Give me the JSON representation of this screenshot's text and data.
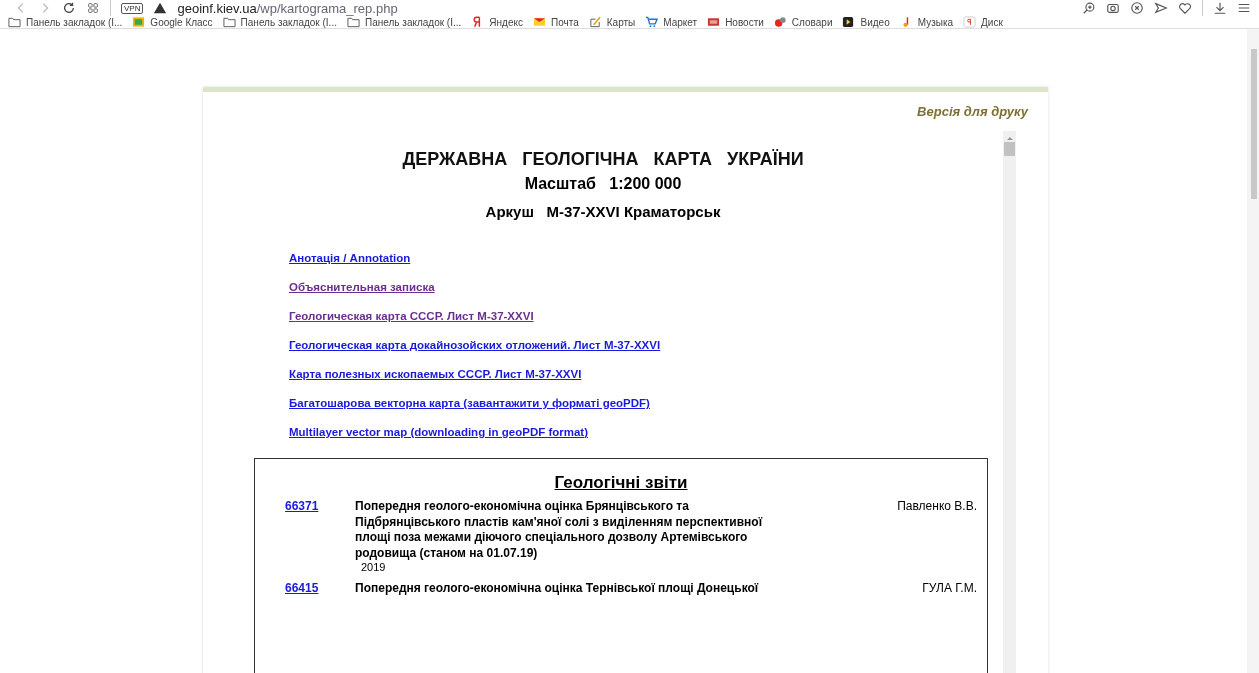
{
  "browser": {
    "url_host": "geoinf.kiev.ua",
    "url_path": "/wp/kartograma_rep.php",
    "vpn_label": "VPN"
  },
  "bookmarks": [
    {
      "label": "Панель закладок (I...",
      "kind": "folder"
    },
    {
      "label": "Google Класс",
      "kind": "classroom"
    },
    {
      "label": "Панель закладок (I...",
      "kind": "folder"
    },
    {
      "label": "Панель закладок (I...",
      "kind": "folder"
    },
    {
      "label": "Яндекс",
      "kind": "ya"
    },
    {
      "label": "Почта",
      "kind": "mail"
    },
    {
      "label": "Карты",
      "kind": "maps"
    },
    {
      "label": "Маркет",
      "kind": "cart"
    },
    {
      "label": "Новости",
      "kind": "news"
    },
    {
      "label": "Словари",
      "kind": "dict"
    },
    {
      "label": "Видео",
      "kind": "video"
    },
    {
      "label": "Музыка",
      "kind": "music"
    },
    {
      "label": "Диск",
      "kind": "disk"
    }
  ],
  "print_link": "Версія для друку",
  "heading": {
    "title": "ДЕРЖАВНА   ГЕОЛОГІЧНА   КАРТА   УКРАЇНИ",
    "scale": "Масштаб   1:200 000",
    "sheet": "Аркуш   М-37-XXVI Краматорськ"
  },
  "links": [
    {
      "label": "Анотація / Annotation",
      "visited": false
    },
    {
      "label": "Объяснительная записка",
      "visited": true
    },
    {
      "label": "Геологическая карта СССР. Лист М-37-XXVI",
      "visited": true
    },
    {
      "label": "Геологическая карта докайнозойских отложений. Лист М-37-XXVI",
      "visited": false
    },
    {
      "label": "Карта полезных ископаемых СССР. Лист М-37-XXVI",
      "visited": false
    },
    {
      "label": "Багатошарова векторна карта (завантажити у форматі geoPDF)",
      "visited": false
    },
    {
      "label": "Multilayer vector map (downloading in geoPDF format)",
      "visited": false
    }
  ],
  "reports": {
    "title": "Геологічні звіти",
    "rows": [
      {
        "number": "66371",
        "title": "Попередня геолого-економічна оцінка Брянцівського та Підбрянцівського пластів кам'яної солі з виділенням перспективної площі поза межами діючого спеціального дозволу Артемівського родовища (станом на 01.07.19)",
        "year": "2019",
        "authors": [
          "Павленко В.В."
        ]
      },
      {
        "number": "66415",
        "title": "Попередня геолого-економічна оцінка Тернівської площі Донецької",
        "authors": [
          "ГУЛА Г.М."
        ]
      }
    ]
  }
}
